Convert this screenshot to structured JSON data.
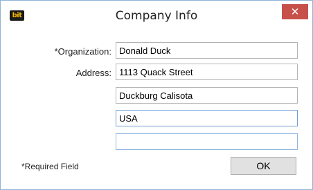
{
  "window": {
    "title": "Company Info",
    "app_logo_text": "bit",
    "close_glyph": "✕",
    "close_icon": "close-icon",
    "close_color": "#c7504a"
  },
  "form": {
    "organization_label": "*Organization:",
    "organization_value": "Donald Duck",
    "address_label": "Address:",
    "address_line1": "1113 Quack Street",
    "address_line2": "Duckburg Calisota",
    "address_line3": "USA",
    "address_line4": ""
  },
  "footer": {
    "required_note": "*Required Field",
    "ok_label": "OK"
  }
}
